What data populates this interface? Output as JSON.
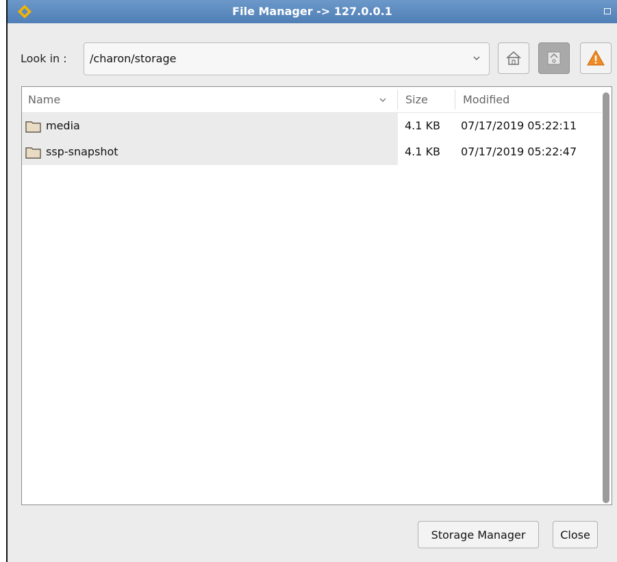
{
  "window": {
    "title": "File Manager -> 127.0.0.1"
  },
  "toolbar": {
    "lookin_label": "Look in :",
    "path_value": "/charon/storage"
  },
  "table": {
    "headers": {
      "name": "Name",
      "size": "Size",
      "modified": "Modified"
    },
    "rows": [
      {
        "name": "media",
        "size": "4.1 KB",
        "modified": "07/17/2019 05:22:11"
      },
      {
        "name": "ssp-snapshot",
        "size": "4.1 KB",
        "modified": "07/17/2019 05:22:47"
      }
    ]
  },
  "buttons": {
    "storage_manager": "Storage Manager",
    "close": "Close"
  },
  "icons": {
    "app": "app-logo-icon",
    "maximize": "maximize-icon",
    "dropdown": "chevron-down-icon",
    "home": "home-icon",
    "up": "up-directory-icon",
    "warning": "warning-icon",
    "folder": "folder-icon",
    "sort": "sort-chevron-icon"
  },
  "colors": {
    "titlebar": "#5b8bc0",
    "warning": "#f08a24",
    "folder": "#e8dcc4"
  }
}
